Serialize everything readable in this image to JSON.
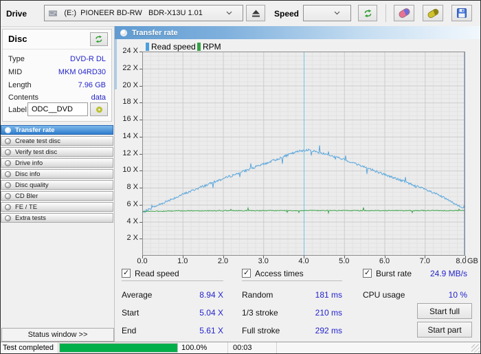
{
  "toolbar": {
    "drive_label": "Drive",
    "drive_value": "(E:)  PIONEER BD-RW   BDR-X13U 1.01",
    "speed_label": "Speed",
    "speed_value": "",
    "icons": [
      "drive-icon",
      "eject-icon",
      "refresh-icon",
      "eraser-icon",
      "highlighter-icon",
      "save-icon"
    ]
  },
  "disc_panel": {
    "title": "Disc",
    "rows": [
      {
        "label": "Type",
        "value": "DVD-R DL"
      },
      {
        "label": "MID",
        "value": "MKM 04RD30"
      },
      {
        "label": "Length",
        "value": "7.96 GB"
      },
      {
        "label": "Contents",
        "value": "data"
      }
    ],
    "label_field": {
      "label": "Label",
      "value": "ODC__DVD"
    }
  },
  "menu": {
    "items": [
      {
        "label": "Transfer rate",
        "selected": true
      },
      {
        "label": "Create test disc",
        "selected": false
      },
      {
        "label": "Verify test disc",
        "selected": false
      },
      {
        "label": "Drive info",
        "selected": false
      },
      {
        "label": "Disc info",
        "selected": false
      },
      {
        "label": "Disc quality",
        "selected": false
      },
      {
        "label": "CD Bler",
        "selected": false
      },
      {
        "label": "FE / TE",
        "selected": false
      },
      {
        "label": "Extra tests",
        "selected": false
      }
    ]
  },
  "status_window_button": "Status window >>",
  "panel": {
    "title": "Transfer rate"
  },
  "chart_data": {
    "type": "line",
    "title": "Transfer rate",
    "x_unit": "GB",
    "xlim": [
      0,
      8
    ],
    "ylim": [
      0,
      24
    ],
    "x_ticks": [
      "0.0",
      "1.0",
      "2.0",
      "3.0",
      "4.0",
      "5.0",
      "6.0",
      "7.0",
      "8.0"
    ],
    "y_ticks": [
      "24 X",
      "22 X",
      "20 X",
      "18 X",
      "16 X",
      "14 X",
      "12 X",
      "10 X",
      "8 X",
      "6 X",
      "4 X",
      "2 X"
    ],
    "grid": {
      "major_x_step": 1,
      "minor_x_step": 0.2,
      "major_y_step": 2,
      "minor_y_step": 0.5
    },
    "legend": [
      {
        "name": "Read speed",
        "color": "#4d9fdc"
      },
      {
        "name": "RPM",
        "color": "#35a243"
      }
    ],
    "series": [
      {
        "name": "Read speed",
        "color": "#5aa7dc",
        "noise": 0.14,
        "spike_prob": 0.03,
        "spike_amp": 0.8,
        "keypoints": [
          [
            0,
            5.05
          ],
          [
            0.3,
            5.75
          ],
          [
            0.7,
            6.6
          ],
          [
            1,
            7.2
          ],
          [
            1.5,
            8.15
          ],
          [
            2,
            9.05
          ],
          [
            2.5,
            9.9
          ],
          [
            3,
            10.75
          ],
          [
            3.4,
            11.45
          ],
          [
            3.7,
            12.0
          ],
          [
            3.9,
            12.3
          ],
          [
            4.05,
            12.45
          ],
          [
            4.2,
            12.35
          ],
          [
            4.5,
            12.0
          ],
          [
            5,
            11.3
          ],
          [
            5.5,
            10.45
          ],
          [
            6,
            9.55
          ],
          [
            6.5,
            8.7
          ],
          [
            7,
            7.8
          ],
          [
            7.4,
            7.0
          ],
          [
            7.7,
            6.2
          ],
          [
            7.9,
            5.8
          ],
          [
            8,
            5.6
          ]
        ]
      },
      {
        "name": "RPM",
        "color": "#3da24b",
        "noise": 0.045,
        "spike_prob": 0.025,
        "spike_amp": 0.32,
        "keypoints": [
          [
            0,
            5.2
          ],
          [
            1,
            5.28
          ],
          [
            4,
            5.3
          ],
          [
            7,
            5.3
          ],
          [
            8,
            5.3
          ]
        ]
      }
    ],
    "markers": [
      {
        "x": 4.0,
        "color": "#6fc9dd",
        "width": 1
      },
      {
        "x": 8.0,
        "color": "#4576c8",
        "width": 2
      }
    ]
  },
  "stats": {
    "read_speed": {
      "title": "Read speed",
      "checked": true,
      "rows": [
        {
          "label": "Average",
          "value": "8.94 X"
        },
        {
          "label": "Start",
          "value": "5.04 X"
        },
        {
          "label": "End",
          "value": "5.61 X"
        }
      ]
    },
    "access_times": {
      "title": "Access times",
      "checked": true,
      "rows": [
        {
          "label": "Random",
          "value": "181 ms"
        },
        {
          "label": "1/3 stroke",
          "value": "210 ms"
        },
        {
          "label": "Full stroke",
          "value": "292 ms"
        }
      ]
    },
    "burst": {
      "title": "Burst rate",
      "checked": true,
      "value": "24.9 MB/s",
      "cpu_label": "CPU usage",
      "cpu_value": "10 %"
    },
    "buttons": {
      "start_full": "Start full",
      "start_part": "Start part"
    }
  },
  "statusbar": {
    "text": "Test completed",
    "progress_label": "100.0%",
    "progress_value": 100,
    "time": "00:03"
  }
}
